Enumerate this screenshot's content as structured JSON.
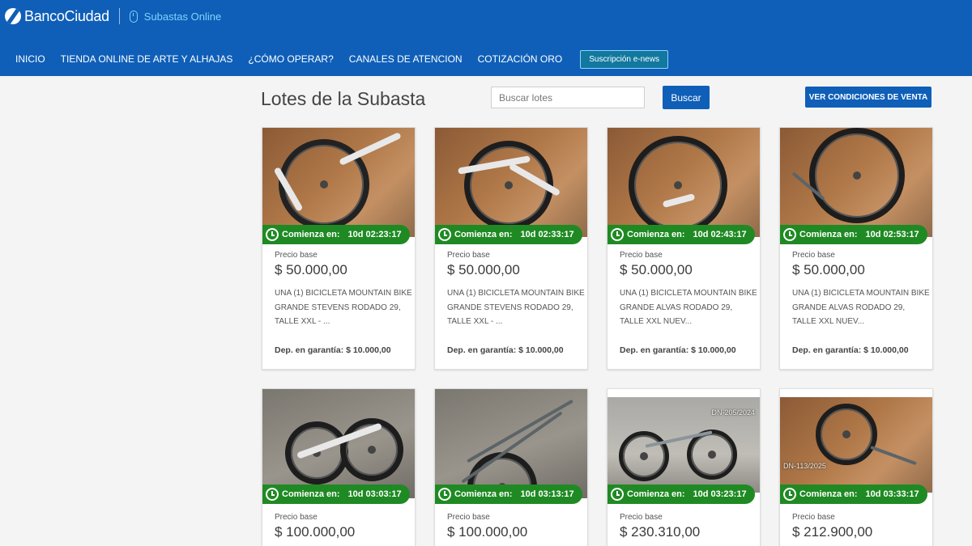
{
  "header": {
    "brand": "BancoCiudad",
    "product": "Subastas Online",
    "nav": [
      "INICIO",
      "TIENDA ONLINE DE ARTE Y ALHAJAS",
      "¿CÓMO OPERAR?",
      "CANALES DE ATENCION",
      "COTIZACIÓN ORO"
    ],
    "newsletter_label": "Suscripción e-news",
    "accent_color": "#0f5fb8"
  },
  "main": {
    "title": "Lotes de la Subasta",
    "search_placeholder": "Buscar lotes",
    "search_button": "Buscar",
    "terms_button": "VER CONDICIONES DE VENTA"
  },
  "lot_labels": {
    "starts_in": "Comienza en:",
    "base_price": "Precio base",
    "deposit": "Dep. en garantía:"
  },
  "lots": [
    {
      "countdown": "10d 02:23:17",
      "price": "$ 50.000,00",
      "description": "UNA (1) BICICLETA MOUNTAIN BIKE GRANDE STEVENS RODADO 29, TALLE XXL - ...",
      "deposit": "$ 10.000,00",
      "photo_tag": ""
    },
    {
      "countdown": "10d 02:33:17",
      "price": "$ 50.000,00",
      "description": "UNA (1) BICICLETA MOUNTAIN BIKE GRANDE STEVENS RODADO 29, TALLE XXL - ...",
      "deposit": "$ 10.000,00",
      "photo_tag": ""
    },
    {
      "countdown": "10d 02:43:17",
      "price": "$ 50.000,00",
      "description": "UNA (1) BICICLETA MOUNTAIN BIKE GRANDE ALVAS RODADO 29, TALLE XXL NUEV...",
      "deposit": "$ 10.000,00",
      "photo_tag": ""
    },
    {
      "countdown": "10d 02:53:17",
      "price": "$ 50.000,00",
      "description": "UNA (1) BICICLETA MOUNTAIN BIKE GRANDE ALVAS RODADO 29, TALLE XXL NUEV...",
      "deposit": "$ 10.000,00",
      "photo_tag": ""
    },
    {
      "countdown": "10d 03:03:17",
      "price": "$ 100.000,00",
      "photo_tag": ""
    },
    {
      "countdown": "10d 03:13:17",
      "price": "$ 100.000,00",
      "photo_tag": ""
    },
    {
      "countdown": "10d 03:23:17",
      "price": "$ 230.310,00",
      "photo_tag": "DN-205/2024"
    },
    {
      "countdown": "10d 03:33:17",
      "price": "$ 212.900,00",
      "photo_tag": "DN-113/2025"
    }
  ],
  "timer_color": "#1f8a23"
}
